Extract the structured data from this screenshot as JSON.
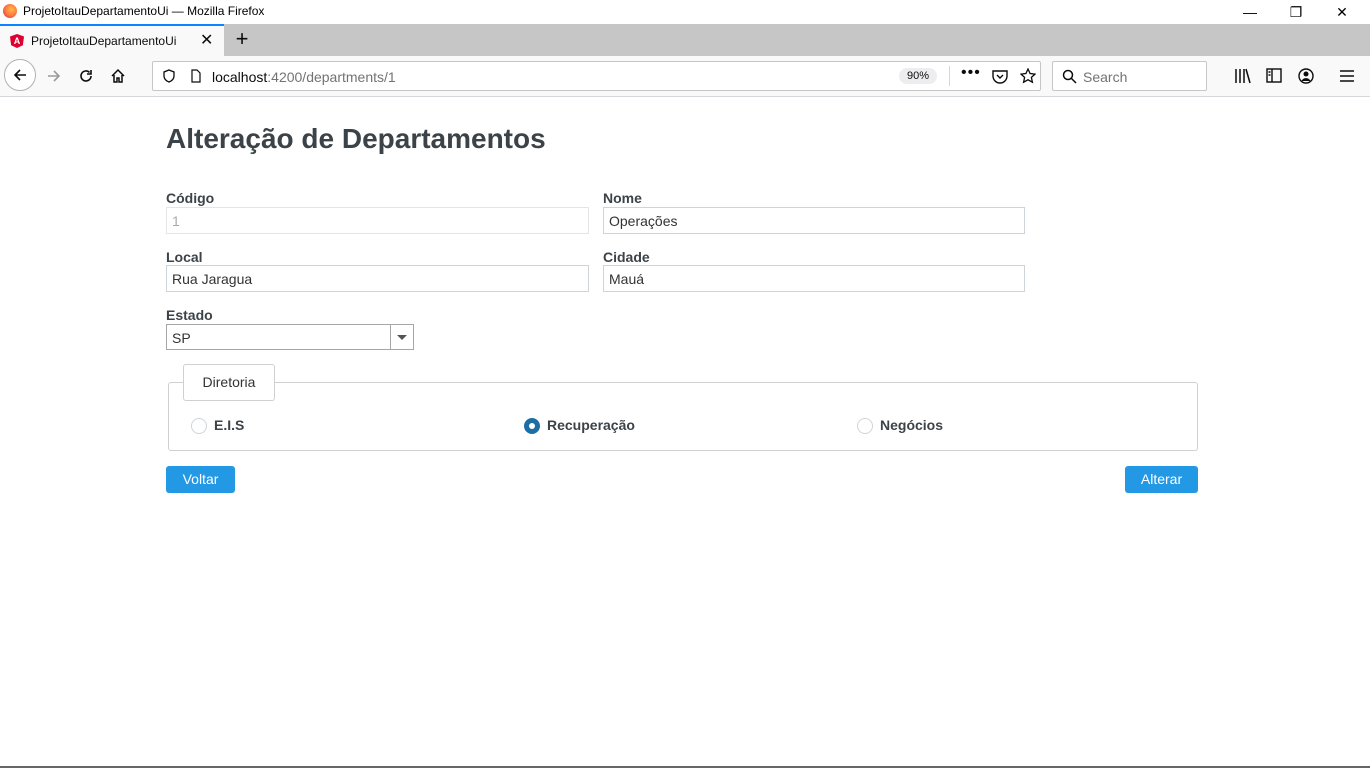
{
  "window": {
    "title": "ProjetoItauDepartamentoUi — Mozilla Firefox",
    "controls": {
      "minimize": "—",
      "restore": "❐",
      "close": "✕"
    }
  },
  "tab": {
    "label": "ProjetoItauDepartamentoUi",
    "close": "✕",
    "new_tab": "+"
  },
  "navbar": {
    "url_host": "localhost",
    "url_path": ":4200/departments/1",
    "zoom": "90%",
    "search_placeholder": "Search",
    "icons": [
      "back-icon",
      "forward-icon",
      "reload-icon",
      "home-icon",
      "shield-icon",
      "more-icon",
      "pocket-icon",
      "bookmark-star-icon",
      "search-icon",
      "library-icon",
      "sidebar-icon",
      "account-icon",
      "menu-icon"
    ]
  },
  "page": {
    "title": "Alteração de Departamentos",
    "fields": {
      "codigo": {
        "label": "Código",
        "value": "1"
      },
      "nome": {
        "label": "Nome",
        "value": "Operações"
      },
      "local": {
        "label": "Local",
        "value": "Rua Jaragua"
      },
      "cidade": {
        "label": "Cidade",
        "value": "Mauá"
      },
      "estado": {
        "label": "Estado",
        "value": "SP"
      }
    },
    "diretoria": {
      "legend": "Diretoria",
      "options": [
        {
          "label": "E.I.S",
          "checked": false
        },
        {
          "label": "Recuperação",
          "checked": true
        },
        {
          "label": "Negócios",
          "checked": false
        }
      ]
    },
    "buttons": {
      "back": "Voltar",
      "submit": "Alterar"
    }
  },
  "colors": {
    "primary_button": "#2399e5",
    "radio_checked": "#1c6ea4",
    "tab_accent": "#0a84ff"
  }
}
